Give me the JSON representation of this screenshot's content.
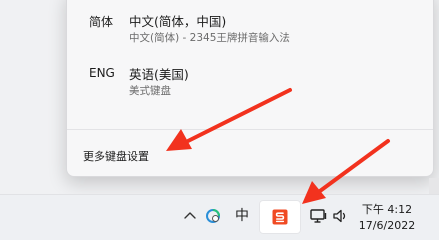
{
  "language_flyout": {
    "items": [
      {
        "code": "简体",
        "name": "中文(简体，中国)",
        "description": "中文(简体) - 2345王牌拼音输入法"
      },
      {
        "code": "ENG",
        "name": "英语(美国)",
        "description": "美式键盘"
      }
    ],
    "more_settings_label": "更多键盘设置"
  },
  "taskbar": {
    "tray_icons": [
      "chevron-up-icon",
      "cloud-sync-icon",
      "input-mode-icon",
      "ime-s-icon",
      "network-monitor-icon",
      "speaker-icon"
    ],
    "input_mode_glyph": "中",
    "clock": {
      "time": "下午 4:12",
      "date": "17/6/2022"
    }
  },
  "colors": {
    "annotation_arrow": "#f2321e",
    "ime_accent": "#f04a23"
  }
}
